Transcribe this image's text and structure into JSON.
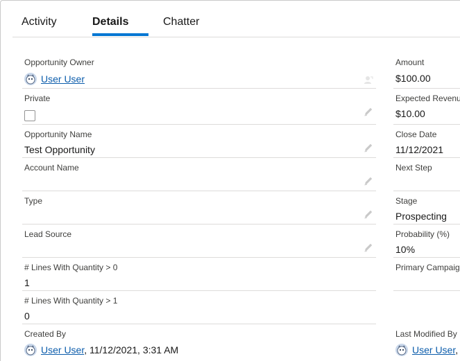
{
  "tabs": [
    {
      "label": "Activity"
    },
    {
      "label": "Details"
    },
    {
      "label": "Chatter"
    }
  ],
  "left_fields": {
    "opportunity_owner": {
      "label": "Opportunity Owner",
      "value": "User User"
    },
    "private": {
      "label": "Private",
      "checked": false
    },
    "opportunity_name": {
      "label": "Opportunity Name",
      "value": "Test Opportunity"
    },
    "account_name": {
      "label": "Account Name",
      "value": ""
    },
    "type": {
      "label": "Type",
      "value": ""
    },
    "lead_source": {
      "label": "Lead Source",
      "value": ""
    },
    "lines_qty_gt0": {
      "label": "# Lines With Quantity > 0",
      "value": "1"
    },
    "lines_qty_gt1": {
      "label": "# Lines With Quantity > 1",
      "value": "0"
    },
    "created_by": {
      "label": "Created By",
      "user": "User User",
      "timestamp": ", 11/12/2021, 3:31 AM"
    }
  },
  "right_fields": {
    "amount": {
      "label": "Amount",
      "value": "$100.00"
    },
    "expected_revenue": {
      "label": "Expected Revenu",
      "value": "$10.00"
    },
    "close_date": {
      "label": "Close Date",
      "value": "11/12/2021"
    },
    "next_step": {
      "label": "Next Step",
      "value": ""
    },
    "stage": {
      "label": "Stage",
      "value": "Prospecting"
    },
    "probability": {
      "label": "Probability (%)",
      "value": "10%"
    },
    "primary_campaign": {
      "label": "Primary Campaig",
      "value": ""
    },
    "last_modified_by": {
      "label": "Last Modified By",
      "user": "User User",
      "suffix": ","
    }
  },
  "colors": {
    "accent": "#0176d3",
    "link": "#0b5cab",
    "divider": "#dddbda"
  }
}
